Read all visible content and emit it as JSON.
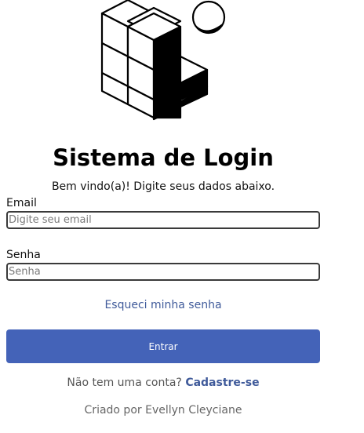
{
  "header": {
    "title": "Sistema de Login",
    "subtitle": "Bem vindo(a)! Digite seus dados abaixo."
  },
  "form": {
    "email": {
      "label": "Email",
      "placeholder": "Digite seu email",
      "value": ""
    },
    "password": {
      "label": "Senha",
      "placeholder": "Senha",
      "value": ""
    },
    "forgot_label": "Esqueci minha senha",
    "submit_label": "Entrar"
  },
  "signup": {
    "prompt": "Não tem uma conta?",
    "link_label": "Cadastre-se"
  },
  "footer": {
    "credit": "Criado por Evellyn Cleyciane"
  },
  "colors": {
    "accent": "#4463b8",
    "link": "#3f5a9a"
  },
  "icons": {
    "logo": "isometric-cubes-sphere-icon"
  }
}
